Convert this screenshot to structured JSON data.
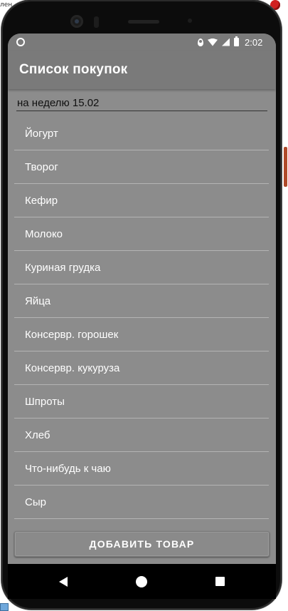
{
  "status_bar": {
    "time": "2:02",
    "icons": [
      "record-circle-icon",
      "location-icon",
      "wifi-icon",
      "signal-icon",
      "battery-icon"
    ]
  },
  "app_bar": {
    "title": "Список покупок"
  },
  "list_name_field": {
    "value": "на неделю 15.02"
  },
  "items": [
    {
      "label": "Йогурт"
    },
    {
      "label": "Творог"
    },
    {
      "label": "Кефир"
    },
    {
      "label": "Молоко"
    },
    {
      "label": "Куриная грудка"
    },
    {
      "label": "Яйца"
    },
    {
      "label": "Консервр. горошек"
    },
    {
      "label": "Консервр. кукуруза"
    },
    {
      "label": "Шпроты"
    },
    {
      "label": "Хлеб"
    },
    {
      "label": "Что-нибудь к чаю"
    },
    {
      "label": "Сыр"
    }
  ],
  "add_button": {
    "label": "ДОБАВИТЬ ТОВАР"
  },
  "nav_bar": {
    "icons": [
      "back-icon",
      "home-icon",
      "recents-icon"
    ]
  },
  "colors": {
    "screen_background": "#8c8c8c",
    "app_bar": "#7a7a7a",
    "text": "#ffffff",
    "divider": "#b4b4b4"
  }
}
